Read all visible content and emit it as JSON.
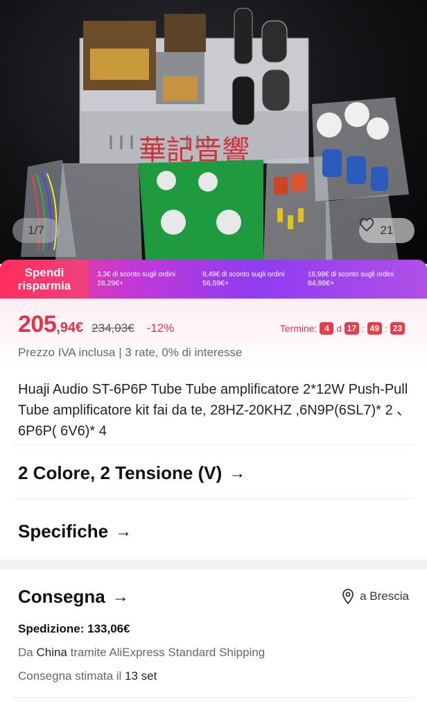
{
  "gallery": {
    "counter": "1/7",
    "watermark": "華記音響",
    "favorites_count": "21"
  },
  "promo": {
    "badge_line1": "Spendi",
    "badge_line2": "risparmia",
    "tiers": [
      {
        "discount": "3,3€ di sconto sugli ordini",
        "threshold": "28,29€+"
      },
      {
        "discount": "8,49€ di sconto sugli ordini",
        "threshold": "56,59€+"
      },
      {
        "discount": "16,98€ di sconto sugli ordini",
        "threshold": "84,88€+"
      }
    ]
  },
  "price": {
    "integer": "205",
    "decimal": ",94€",
    "original": "234,03€",
    "discount": "-12%",
    "vat_info": "Prezzo IVA inclusa | 3 rate, 0% di interesse"
  },
  "timer": {
    "label": "Termine:",
    "days": "4",
    "days_unit": "d",
    "hours": "17",
    "minutes": "49",
    "seconds": "23",
    "sep": ":"
  },
  "product": {
    "title": "Huaji Audio ST-6P6P Tube Tube amplificatore 2*12W Push-Pull Tube amplificatore kit fai da te, 28HZ-20KHZ ,6N9P(6SL7)* 2 、 6P6P( 6V6)* 4"
  },
  "variants": {
    "label": "2 Colore, 2 Tensione (V)",
    "arrow": "→"
  },
  "specs": {
    "label": "Specifiche",
    "arrow": "→"
  },
  "delivery": {
    "label": "Consegna",
    "arrow": "→",
    "location": "a Brescia",
    "shipping_cost": "Spedizione: 133,06€",
    "from_prefix": "Da ",
    "from_country": "China",
    "from_suffix": " tramite AliExpress Standard Shipping",
    "eta_prefix": "Consegna stimata il ",
    "eta_date": "13 set"
  },
  "colors": {
    "accent": "#e8304a",
    "promo_start": "#ff3b6b",
    "promo_end": "#8f3cf0"
  }
}
